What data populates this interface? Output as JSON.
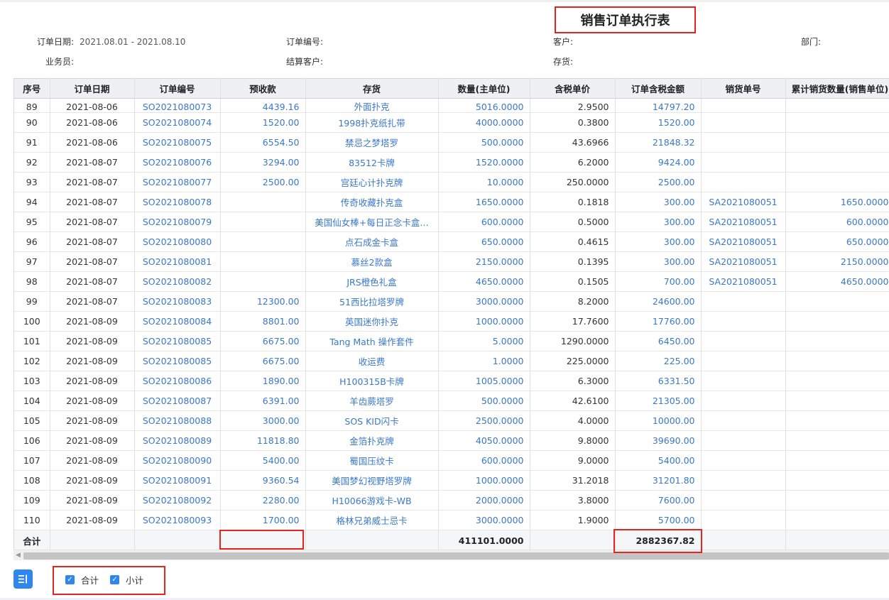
{
  "report": {
    "title": "销售订单执行表",
    "filters": [
      {
        "label": "订单日期:",
        "value": "2021.08.01 - 2021.08.10"
      },
      {
        "label": "订单编号:",
        "value": ""
      },
      {
        "label": "客户:",
        "value": ""
      },
      {
        "label": "部门:",
        "value": ""
      },
      {
        "label": "业务员:",
        "value": ""
      },
      {
        "label": "结算客户:",
        "value": ""
      },
      {
        "label": "存货:",
        "value": ""
      }
    ]
  },
  "grid": {
    "columns": [
      "序号",
      "订单日期",
      "订单编号",
      "预收款",
      "存货",
      "数量(主单位)",
      "含税单价",
      "订单含税金额",
      "销货单号",
      "累计销货数量(销售单位)"
    ],
    "rows": [
      [
        "89",
        "2021-08-06",
        "SO2021080073",
        "4439.16",
        "外面扑克",
        "5016.0000",
        "2.9500",
        "14797.20",
        "",
        ""
      ],
      [
        "90",
        "2021-08-06",
        "SO2021080074",
        "1520.00",
        "1998扑克纸扎带",
        "4000.0000",
        "0.3800",
        "1520.00",
        "",
        ""
      ],
      [
        "91",
        "2021-08-06",
        "SO2021080075",
        "6554.50",
        "禁忌之梦塔罗",
        "500.0000",
        "43.6966",
        "21848.32",
        "",
        ""
      ],
      [
        "92",
        "2021-08-07",
        "SO2021080076",
        "3294.00",
        "83512卡牌",
        "1520.0000",
        "6.2000",
        "9424.00",
        "",
        ""
      ],
      [
        "93",
        "2021-08-07",
        "SO2021080077",
        "2500.00",
        "宫廷心计扑克牌",
        "10.0000",
        "250.0000",
        "2500.00",
        "",
        ""
      ],
      [
        "94",
        "2021-08-07",
        "SO2021080078",
        "",
        "传奇收藏扑克盒",
        "1650.0000",
        "0.1818",
        "300.00",
        "SA2021080051",
        "1650.0000"
      ],
      [
        "95",
        "2021-08-07",
        "SO2021080079",
        "",
        "美国仙女棒+每日正念卡盒…",
        "600.0000",
        "0.5000",
        "300.00",
        "SA2021080051",
        "600.0000"
      ],
      [
        "96",
        "2021-08-07",
        "SO2021080080",
        "",
        "点石成金卡盒",
        "650.0000",
        "0.4615",
        "300.00",
        "SA2021080051",
        "650.0000"
      ],
      [
        "97",
        "2021-08-07",
        "SO2021080081",
        "",
        "慕丝2款盒",
        "2150.0000",
        "0.1395",
        "300.00",
        "SA2021080051",
        "2150.0000"
      ],
      [
        "98",
        "2021-08-07",
        "SO2021080082",
        "",
        "JRS橙色礼盒",
        "4650.0000",
        "0.1505",
        "700.00",
        "SA2021080051",
        "4650.0000"
      ],
      [
        "99",
        "2021-08-07",
        "SO2021080083",
        "12300.00",
        "51西比拉塔罗牌",
        "3000.0000",
        "8.2000",
        "24600.00",
        "",
        ""
      ],
      [
        "100",
        "2021-08-09",
        "SO2021080084",
        "8801.00",
        "英国迷你扑克",
        "1000.0000",
        "17.7600",
        "17760.00",
        "",
        ""
      ],
      [
        "101",
        "2021-08-09",
        "SO2021080085",
        "6675.00",
        "Tang Math 操作套件",
        "5.0000",
        "1290.0000",
        "6450.00",
        "",
        ""
      ],
      [
        "102",
        "2021-08-09",
        "SO2021080085",
        "6675.00",
        "收运费",
        "1.0000",
        "225.0000",
        "225.00",
        "",
        ""
      ],
      [
        "103",
        "2021-08-09",
        "SO2021080086",
        "1890.00",
        "H100315B卡牌",
        "1005.0000",
        "6.3000",
        "6331.50",
        "",
        ""
      ],
      [
        "104",
        "2021-08-09",
        "SO2021080087",
        "6391.00",
        "羊齿蕨塔罗",
        "500.0000",
        "42.6100",
        "21305.00",
        "",
        ""
      ],
      [
        "105",
        "2021-08-09",
        "SO2021080088",
        "3000.00",
        "SOS KID闪卡",
        "2500.0000",
        "4.0000",
        "10000.00",
        "",
        ""
      ],
      [
        "106",
        "2021-08-09",
        "SO2021080089",
        "11818.80",
        "金箔扑克牌",
        "4050.0000",
        "9.8000",
        "39690.00",
        "",
        ""
      ],
      [
        "107",
        "2021-08-09",
        "SO2021080090",
        "5400.00",
        "蜀国压纹卡",
        "600.0000",
        "9.0000",
        "5400.00",
        "",
        ""
      ],
      [
        "108",
        "2021-08-09",
        "SO2021080091",
        "9360.54",
        "美国梦幻视野塔罗牌",
        "1000.0000",
        "31.2018",
        "31201.80",
        "",
        ""
      ],
      [
        "109",
        "2021-08-09",
        "SO2021080092",
        "2280.00",
        "H10066游戏卡-WB",
        "2000.0000",
        "3.8000",
        "7600.00",
        "",
        ""
      ],
      [
        "110",
        "2021-08-09",
        "SO2021080093",
        "1700.00",
        "格林兄弟威士忌卡",
        "3000.0000",
        "1.9000",
        "5700.00",
        "",
        ""
      ]
    ],
    "footer": {
      "label": "合计",
      "prepaid_total": "",
      "quantity_total": "411101.0000",
      "amount_total": "2882367.82"
    }
  },
  "bottom_bar": {
    "settings_icon": "column-settings-icon",
    "total_label": "合计",
    "total_checked": true,
    "subtotal_label": "小计",
    "subtotal_checked": true
  },
  "colors": {
    "link": "#3a78c9",
    "highlight": "#e8231f",
    "primary": "#2f86eb",
    "header_bg": "#eef0f3"
  }
}
